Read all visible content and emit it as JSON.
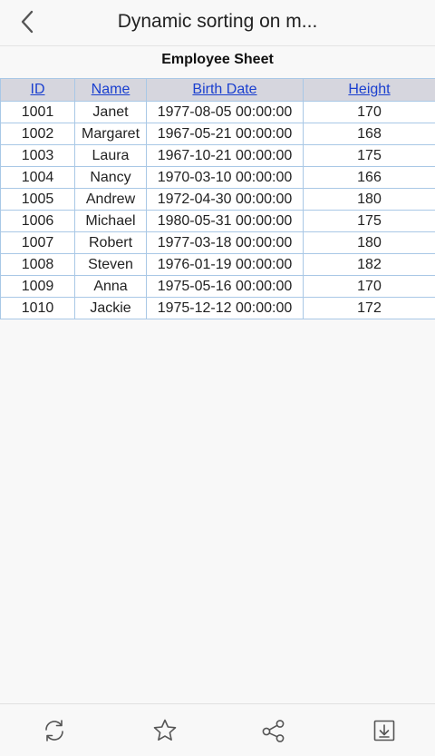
{
  "nav": {
    "title": "Dynamic sorting on m..."
  },
  "sheet": {
    "title": "Employee Sheet"
  },
  "table": {
    "headers": [
      "ID",
      "Name",
      "Birth Date",
      "Height"
    ],
    "rows": [
      [
        "1001",
        "Janet",
        "1977-08-05 00:00:00",
        "170"
      ],
      [
        "1002",
        "Margaret",
        "1967-05-21 00:00:00",
        "168"
      ],
      [
        "1003",
        "Laura",
        "1967-10-21 00:00:00",
        "175"
      ],
      [
        "1004",
        "Nancy",
        "1970-03-10 00:00:00",
        "166"
      ],
      [
        "1005",
        "Andrew",
        "1972-04-30 00:00:00",
        "180"
      ],
      [
        "1006",
        "Michael",
        "1980-05-31 00:00:00",
        "175"
      ],
      [
        "1007",
        "Robert",
        "1977-03-18 00:00:00",
        "180"
      ],
      [
        "1008",
        "Steven",
        "1976-01-19 00:00:00",
        "182"
      ],
      [
        "1009",
        "Anna",
        "1975-05-16 00:00:00",
        "170"
      ],
      [
        "1010",
        "Jackie",
        "1975-12-12 00:00:00",
        "172"
      ]
    ]
  },
  "toolbar": {
    "icons": [
      "refresh-icon",
      "star-icon",
      "share-icon",
      "download-icon"
    ]
  },
  "colors": {
    "header_bg": "#d6d6de",
    "link": "#1a3fcf",
    "grid_border": "#a9c8e6",
    "icon": "#555555"
  }
}
